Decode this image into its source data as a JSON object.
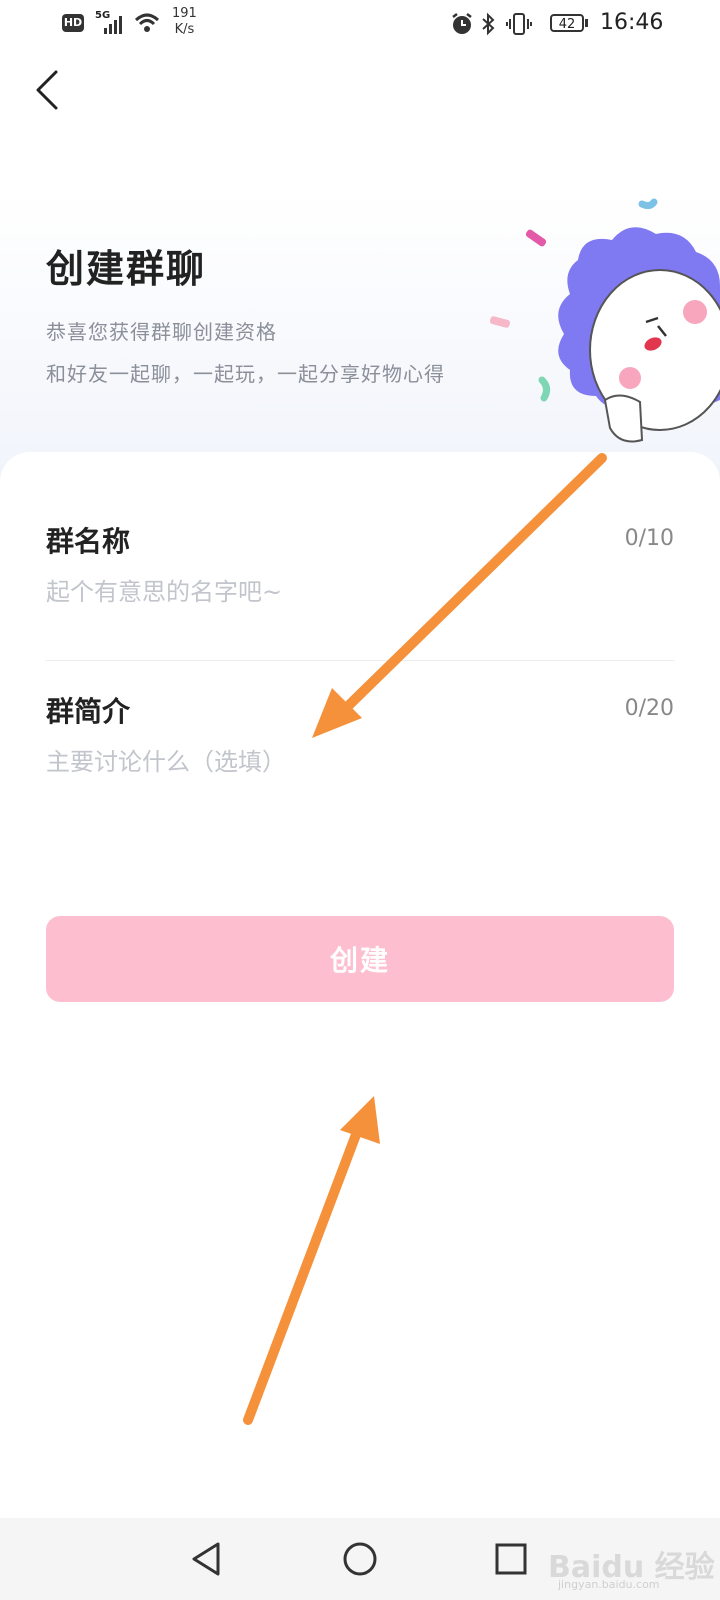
{
  "status_bar": {
    "hd_badge": "HD",
    "network": "5G",
    "speed_value": "191",
    "speed_unit": "K/s",
    "battery": "42",
    "time": "16:46",
    "icons": [
      "signal-icon",
      "wifi-icon",
      "alarm-icon",
      "bluetooth-icon",
      "vibrate-icon",
      "battery-icon"
    ]
  },
  "header": {
    "back_icon": "chevron-left-icon",
    "title": "创建群聊",
    "subtitle_line1": "恭喜您获得群聊创建资格",
    "subtitle_line2": "和好友一起聊，一起玩，一起分享好物心得"
  },
  "form": {
    "name_label": "群名称",
    "name_counter": "0/10",
    "name_placeholder": "起个有意思的名字吧~",
    "name_value": "",
    "intro_label": "群简介",
    "intro_counter": "0/20",
    "intro_placeholder": "主要讨论什么（选填）",
    "intro_value": ""
  },
  "create_button": {
    "label": "创建",
    "color": "#fdbfcf"
  },
  "annotations": {
    "arrow_color": "#f5913a"
  },
  "nav_bar": {
    "buttons": [
      "back-triangle-icon",
      "home-circle-icon",
      "recents-square-icon"
    ]
  },
  "watermark": {
    "brand": "Baidu 经验",
    "url": "jingyan.baidu.com"
  }
}
